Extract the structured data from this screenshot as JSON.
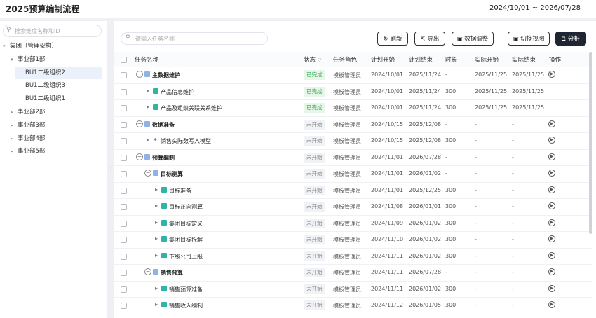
{
  "header": {
    "title": "2025预算编制流程",
    "date_range": "2024/10/01 ~ 2026/07/28"
  },
  "sidebar": {
    "search_placeholder": "搜索维度名称和ID",
    "nodes": [
      {
        "label": "集团（管理架构）",
        "level": 0,
        "expanded": true
      },
      {
        "label": "事业部1部",
        "level": 1,
        "expanded": true
      },
      {
        "label": "BU1二级组织2",
        "level": 2,
        "selected": true
      },
      {
        "label": "BU1二级组织3",
        "level": 2
      },
      {
        "label": "BU1二级组织1",
        "level": 2
      },
      {
        "label": "事业部2部",
        "level": 1,
        "expanded": false
      },
      {
        "label": "事业部3部",
        "level": 1,
        "expanded": false
      },
      {
        "label": "事业部4部",
        "level": 1,
        "expanded": false
      },
      {
        "label": "事业部5部",
        "level": 1,
        "expanded": false
      }
    ]
  },
  "main": {
    "search_placeholder": "请输入任务名称",
    "toolbar": {
      "refresh": "刷新",
      "export": "导出",
      "data_adjust": "数据调整",
      "switch_view": "切换视图",
      "analyze": "分析"
    },
    "columns": {
      "name": "任务名称",
      "status": "状态",
      "role": "任务角色",
      "plan_start": "计划开始",
      "plan_end": "计划结束",
      "duration": "时长",
      "actual_start": "实际开始",
      "actual_end": "实际结束",
      "ops": "操作"
    },
    "rows": [
      {
        "name": "主数据维护",
        "level": 0,
        "kind": "group",
        "ctl": "minus",
        "bold": true,
        "status": "已完成",
        "status_type": "done",
        "role": "模板管理员",
        "plan_start": "2024/10/01",
        "plan_end": "2025/11/24",
        "duration": "-",
        "actual_start": "2025/11/25",
        "actual_end": "2025/11/25",
        "op": true
      },
      {
        "name": "产品信息维护",
        "level": 1,
        "kind": "task",
        "ctl": "arrow",
        "status": "已完成",
        "status_type": "done",
        "role": "模板管理员",
        "plan_start": "2024/10/01",
        "plan_end": "2025/11/24",
        "duration": "300",
        "actual_start": "2025/11/25",
        "actual_end": "2025/11/25",
        "op": false
      },
      {
        "name": "产品及组织关联关系维护",
        "level": 1,
        "kind": "task",
        "ctl": "arrow",
        "status": "已完成",
        "status_type": "done",
        "role": "模板管理员",
        "plan_start": "2024/10/01",
        "plan_end": "2025/11/24",
        "duration": "300",
        "actual_start": "2025/11/25",
        "actual_end": "2025/11/25",
        "op": false
      },
      {
        "name": "数据准备",
        "level": 0,
        "kind": "group",
        "ctl": "minus",
        "bold": true,
        "status": "未开始",
        "status_type": "todo",
        "role": "模板管理员",
        "plan_start": "2024/10/15",
        "plan_end": "2025/12/08",
        "duration": "-",
        "actual_start": "-",
        "actual_end": "-",
        "op": true
      },
      {
        "name": "销售实际数写入模型",
        "level": 1,
        "kind": "link",
        "ctl": "arrow",
        "status": "未开始",
        "status_type": "todo",
        "role": "模板管理员",
        "plan_start": "2024/10/15",
        "plan_end": "2025/12/08",
        "duration": "300",
        "actual_start": "-",
        "actual_end": "-",
        "op": true
      },
      {
        "name": "预算编制",
        "level": 0,
        "kind": "group",
        "ctl": "minus",
        "bold": true,
        "status": "未开始",
        "status_type": "todo",
        "role": "模板管理员",
        "plan_start": "2024/11/01",
        "plan_end": "2026/07/28",
        "duration": "-",
        "actual_start": "-",
        "actual_end": "-",
        "op": true
      },
      {
        "name": "目标测算",
        "level": 1,
        "kind": "group",
        "ctl": "minus",
        "bold": true,
        "status": "未开始",
        "status_type": "todo",
        "role": "模板管理员",
        "plan_start": "2024/11/01",
        "plan_end": "2026/01/02",
        "duration": "-",
        "actual_start": "-",
        "actual_end": "-",
        "op": true
      },
      {
        "name": "目标准备",
        "level": 2,
        "kind": "task",
        "ctl": "arrow",
        "status": "未开始",
        "status_type": "todo",
        "role": "模板管理员",
        "plan_start": "2024/11/01",
        "plan_end": "2025/12/25",
        "duration": "300",
        "actual_start": "-",
        "actual_end": "-",
        "op": true
      },
      {
        "name": "目标正向测算",
        "level": 2,
        "kind": "task",
        "ctl": "arrow",
        "status": "未开始",
        "status_type": "todo",
        "role": "模板管理员",
        "plan_start": "2024/11/08",
        "plan_end": "2026/01/01",
        "duration": "300",
        "actual_start": "-",
        "actual_end": "-",
        "op": true
      },
      {
        "name": "集团目标定义",
        "level": 2,
        "kind": "task",
        "ctl": "arrow",
        "status": "未开始",
        "status_type": "todo",
        "role": "模板管理员",
        "plan_start": "2024/11/09",
        "plan_end": "2026/01/02",
        "duration": "300",
        "actual_start": "-",
        "actual_end": "-",
        "op": true
      },
      {
        "name": "集团目标拆解",
        "level": 2,
        "kind": "task",
        "ctl": "arrow",
        "status": "未开始",
        "status_type": "todo",
        "role": "模板管理员",
        "plan_start": "2024/11/10",
        "plan_end": "2026/01/02",
        "duration": "300",
        "actual_start": "-",
        "actual_end": "-",
        "op": true
      },
      {
        "name": "下级公司上报",
        "level": 2,
        "kind": "task",
        "ctl": "arrow",
        "status": "未开始",
        "status_type": "todo",
        "role": "模板管理员",
        "plan_start": "2024/11/11",
        "plan_end": "2026/01/02",
        "duration": "300",
        "actual_start": "-",
        "actual_end": "-",
        "op": true
      },
      {
        "name": "销售预算",
        "level": 1,
        "kind": "group",
        "ctl": "minus",
        "bold": true,
        "status": "未开始",
        "status_type": "todo",
        "role": "模板管理员",
        "plan_start": "2024/11/11",
        "plan_end": "2026/07/28",
        "duration": "-",
        "actual_start": "-",
        "actual_end": "-",
        "op": true
      },
      {
        "name": "销售预算准备",
        "level": 2,
        "kind": "task",
        "ctl": "arrow",
        "status": "未开始",
        "status_type": "todo",
        "role": "模板管理员",
        "plan_start": "2024/11/11",
        "plan_end": "2026/01/02",
        "duration": "300",
        "actual_start": "-",
        "actual_end": "-",
        "op": true
      },
      {
        "name": "销售收入编制",
        "level": 2,
        "kind": "task",
        "ctl": "arrow",
        "status": "未开始",
        "status_type": "todo",
        "role": "模板管理员",
        "plan_start": "2024/11/12",
        "plan_end": "2026/01/05",
        "duration": "300",
        "actual_start": "-",
        "actual_end": "-",
        "op": true
      }
    ]
  }
}
